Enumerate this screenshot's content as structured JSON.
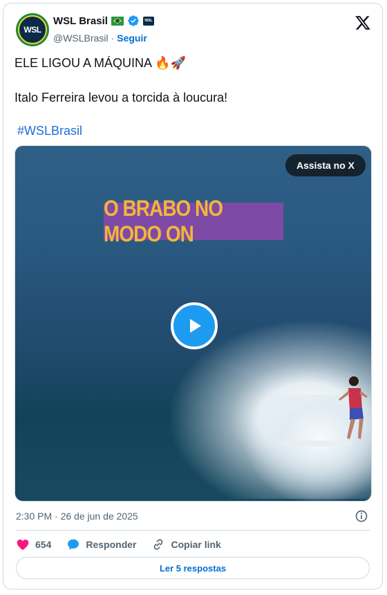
{
  "author": {
    "name": "WSL Brasil",
    "avatar_text": "WSL",
    "mini_logo_text": "WSL",
    "handle": "@WSLBrasil",
    "separator": "·",
    "follow_label": "Seguir"
  },
  "post": {
    "line1": "ELE LIGOU A MÁQUINA",
    "line1_emojis": "🔥🚀",
    "line2": "Italo Ferreira levou a torcida à loucura!",
    "hashtag": "#WSLBrasil"
  },
  "media": {
    "watch_label": "Assista no X",
    "caption": "O BRABO NO MODO ON"
  },
  "meta": {
    "timestamp": "2:30 PM · 26 de jun de 2025"
  },
  "actions": {
    "likes": "654",
    "reply_label": "Responder",
    "copy_label": "Copiar link"
  },
  "replies_button": "Ler 5 respostas",
  "colors": {
    "accent": "#1d9bf0",
    "link": "#006fd6",
    "like": "#f91880",
    "caption_bg": "#7d4aa6",
    "caption_text": "#f2b63a"
  }
}
